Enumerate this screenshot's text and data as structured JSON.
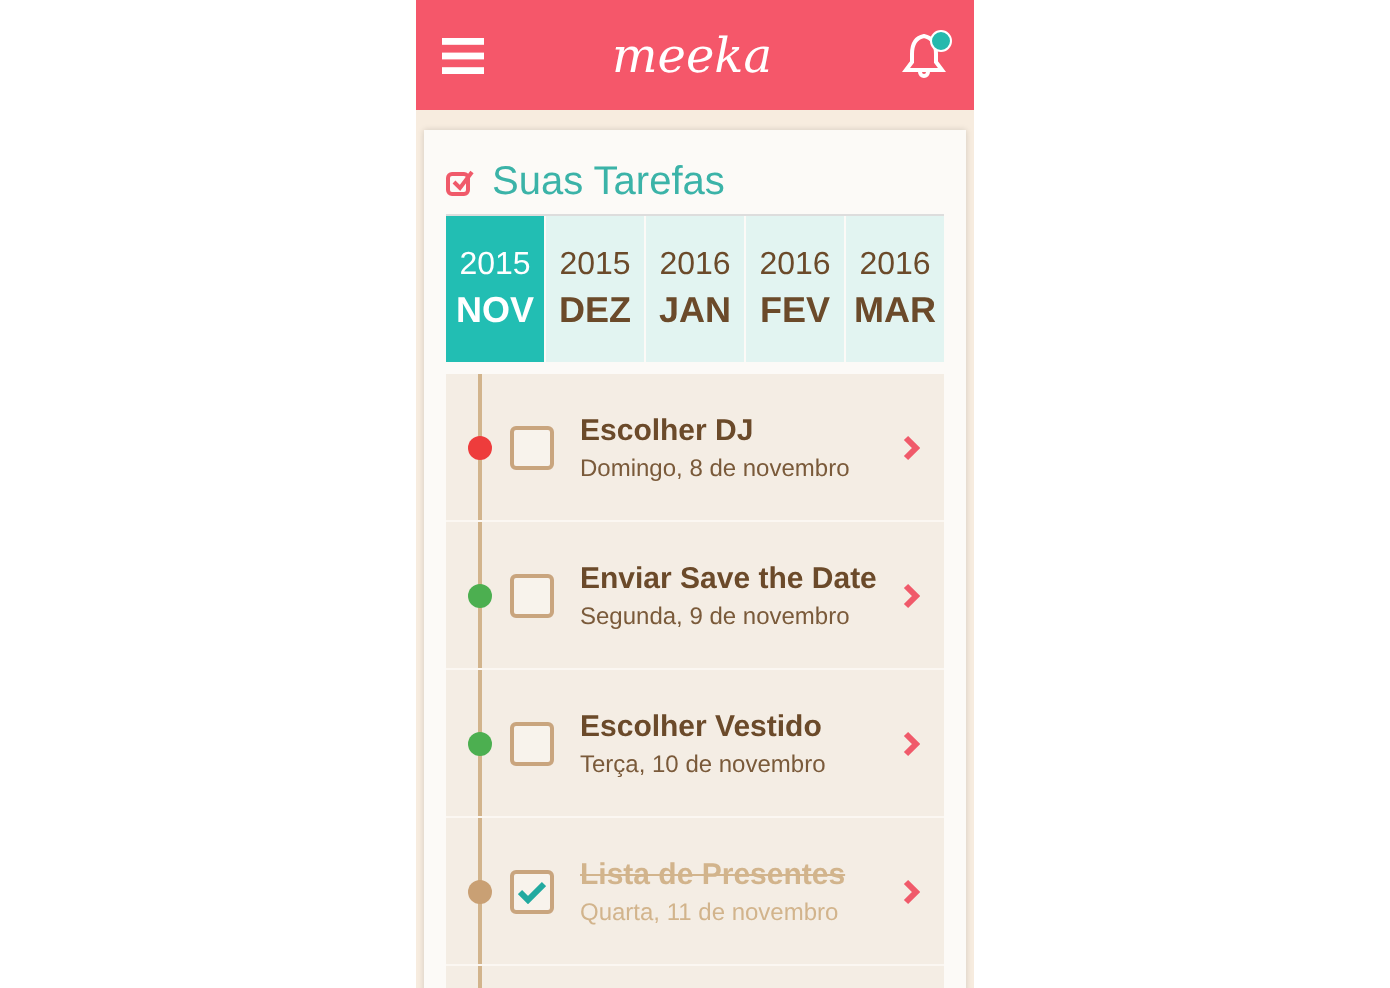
{
  "header": {
    "logo": "meeka",
    "has_notification": true
  },
  "section": {
    "title": "Suas Tarefas"
  },
  "months": [
    {
      "year": "2015",
      "month": "NOV",
      "selected": true
    },
    {
      "year": "2015",
      "month": "DEZ",
      "selected": false
    },
    {
      "year": "2016",
      "month": "JAN",
      "selected": false
    },
    {
      "year": "2016",
      "month": "FEV",
      "selected": false
    },
    {
      "year": "2016",
      "month": "MAR",
      "selected": false
    }
  ],
  "tasks": [
    {
      "title": "Escolher DJ",
      "date": "Domingo, 8 de novembro",
      "color": "#ee3c3c",
      "checked": false
    },
    {
      "title": "Enviar Save the Date",
      "date": "Segunda, 9 de novembro",
      "color": "#4caf50",
      "checked": false
    },
    {
      "title": "Escolher Vestido",
      "date": "Terça, 10 de novembro",
      "color": "#4caf50",
      "checked": false
    },
    {
      "title": "Lista de Presentes",
      "date": "Quarta, 11 de novembro",
      "color": "#c9a074",
      "checked": true
    }
  ]
}
